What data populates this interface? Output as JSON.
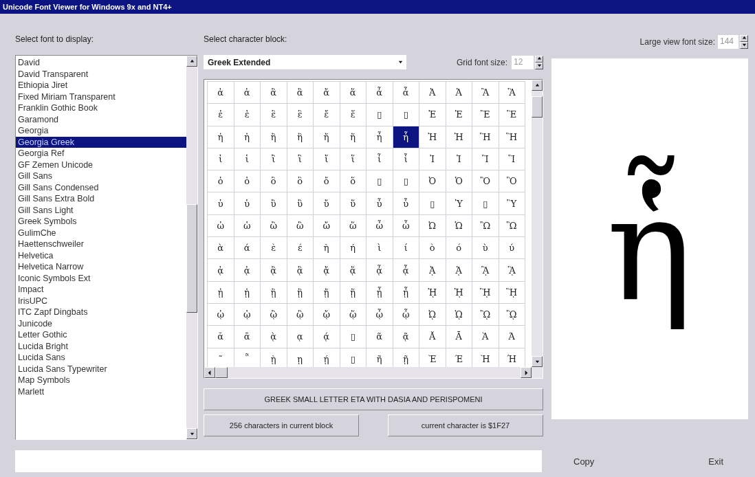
{
  "window": {
    "title": "Unicode Font Viewer for Windows 9x and NT4+"
  },
  "font_panel": {
    "label": "Select font to display:",
    "fonts": [
      {
        "name": "David",
        "selected": false
      },
      {
        "name": "David Transparent",
        "selected": false
      },
      {
        "name": "Ethiopia Jiret",
        "selected": false
      },
      {
        "name": "Fixed Miriam Transparent",
        "selected": false
      },
      {
        "name": "Franklin Gothic Book",
        "selected": false
      },
      {
        "name": "Garamond",
        "selected": false
      },
      {
        "name": "Georgia",
        "selected": false
      },
      {
        "name": "Georgia Greek",
        "selected": true
      },
      {
        "name": "Georgia Ref",
        "selected": false
      },
      {
        "name": "GF Zemen Unicode",
        "selected": false
      },
      {
        "name": "Gill Sans",
        "selected": false
      },
      {
        "name": "Gill Sans Condensed",
        "selected": false
      },
      {
        "name": "Gill Sans Extra Bold",
        "selected": false
      },
      {
        "name": "Gill Sans Light",
        "selected": false
      },
      {
        "name": "Greek Symbols",
        "selected": false
      },
      {
        "name": "GulimChe",
        "selected": false
      },
      {
        "name": "Haettenschweiler",
        "selected": false
      },
      {
        "name": "Helvetica",
        "selected": false
      },
      {
        "name": "Helvetica Narrow",
        "selected": false
      },
      {
        "name": "Iconic Symbols Ext",
        "selected": false
      },
      {
        "name": "Impact",
        "selected": false
      },
      {
        "name": "IrisUPC",
        "selected": false
      },
      {
        "name": "ITC Zapf Dingbats",
        "selected": false
      },
      {
        "name": "Junicode",
        "selected": false
      },
      {
        "name": "Letter Gothic",
        "selected": false
      },
      {
        "name": "Lucida Bright",
        "selected": false
      },
      {
        "name": "Lucida Sans",
        "selected": false
      },
      {
        "name": "Lucida Sans Typewriter",
        "selected": false
      },
      {
        "name": "Map Symbols",
        "selected": false
      },
      {
        "name": "Marlett",
        "selected": false
      }
    ]
  },
  "block_panel": {
    "label": "Select character block:",
    "block": "Greek Extended",
    "grid_font_size_label": "Grid font size:",
    "grid_font_size": "12"
  },
  "grid": {
    "rows": [
      {
        "cells": [
          "ἀ",
          "ἁ",
          "ἂ",
          "ἃ",
          "ἄ",
          "ἅ",
          "ἆ",
          "ἇ",
          "Ἀ",
          "Ἁ",
          "Ἂ",
          "Ἃ"
        ],
        "selected": [
          false,
          false,
          false,
          false,
          false,
          false,
          false,
          false,
          false,
          false,
          false,
          false
        ]
      },
      {
        "cells": [
          "ἐ",
          "ἑ",
          "ἒ",
          "ἓ",
          "ἔ",
          "ἕ",
          "▯",
          "▯",
          "Ἐ",
          "Ἑ",
          "Ἒ",
          "Ἓ"
        ],
        "selected": [
          false,
          false,
          false,
          false,
          false,
          false,
          false,
          false,
          false,
          false,
          false,
          false
        ]
      },
      {
        "cells": [
          "ἠ",
          "ἡ",
          "ἢ",
          "ἣ",
          "ἤ",
          "ἥ",
          "ἦ",
          "ἧ",
          "Ἠ",
          "Ἡ",
          "Ἢ",
          "Ἣ"
        ],
        "selected": [
          false,
          false,
          false,
          false,
          false,
          false,
          false,
          true,
          false,
          false,
          false,
          false
        ]
      },
      {
        "cells": [
          "ἰ",
          "ἱ",
          "ἲ",
          "ἳ",
          "ἴ",
          "ἵ",
          "ἶ",
          "ἷ",
          "Ἰ",
          "Ἱ",
          "Ἲ",
          "Ἳ"
        ],
        "selected": [
          false,
          false,
          false,
          false,
          false,
          false,
          false,
          false,
          false,
          false,
          false,
          false
        ]
      },
      {
        "cells": [
          "ὀ",
          "ὁ",
          "ὂ",
          "ὃ",
          "ὄ",
          "ὅ",
          "▯",
          "▯",
          "Ὀ",
          "Ὁ",
          "Ὂ",
          "Ὃ"
        ],
        "selected": [
          false,
          false,
          false,
          false,
          false,
          false,
          false,
          false,
          false,
          false,
          false,
          false
        ]
      },
      {
        "cells": [
          "ὐ",
          "ὑ",
          "ὒ",
          "ὓ",
          "ὔ",
          "ὕ",
          "ὖ",
          "ὗ",
          "▯",
          "Ὑ",
          "▯",
          "Ὓ"
        ],
        "selected": [
          false,
          false,
          false,
          false,
          false,
          false,
          false,
          false,
          false,
          false,
          false,
          false
        ]
      },
      {
        "cells": [
          "ὠ",
          "ὡ",
          "ὢ",
          "ὣ",
          "ὤ",
          "ὥ",
          "ὦ",
          "ὧ",
          "Ὠ",
          "Ὡ",
          "Ὢ",
          "Ὣ"
        ],
        "selected": [
          false,
          false,
          false,
          false,
          false,
          false,
          false,
          false,
          false,
          false,
          false,
          false
        ]
      },
      {
        "cells": [
          "ὰ",
          "ά",
          "ὲ",
          "έ",
          "ὴ",
          "ή",
          "ὶ",
          "ί",
          "ὸ",
          "ό",
          "ὺ",
          "ύ"
        ],
        "selected": [
          false,
          false,
          false,
          false,
          false,
          false,
          false,
          false,
          false,
          false,
          false,
          false
        ]
      },
      {
        "cells": [
          "ᾀ",
          "ᾁ",
          "ᾂ",
          "ᾃ",
          "ᾄ",
          "ᾅ",
          "ᾆ",
          "ᾇ",
          "ᾈ",
          "ᾉ",
          "ᾊ",
          "ᾋ"
        ],
        "selected": [
          false,
          false,
          false,
          false,
          false,
          false,
          false,
          false,
          false,
          false,
          false,
          false
        ]
      },
      {
        "cells": [
          "ᾐ",
          "ᾑ",
          "ᾒ",
          "ᾓ",
          "ᾔ",
          "ᾕ",
          "ᾖ",
          "ᾗ",
          "ᾘ",
          "ᾙ",
          "ᾚ",
          "ᾛ"
        ],
        "selected": [
          false,
          false,
          false,
          false,
          false,
          false,
          false,
          false,
          false,
          false,
          false,
          false
        ]
      },
      {
        "cells": [
          "ᾠ",
          "ᾡ",
          "ᾢ",
          "ᾣ",
          "ᾤ",
          "ᾥ",
          "ᾦ",
          "ᾧ",
          "ᾨ",
          "ᾩ",
          "ᾪ",
          "ᾫ"
        ],
        "selected": [
          false,
          false,
          false,
          false,
          false,
          false,
          false,
          false,
          false,
          false,
          false,
          false
        ]
      },
      {
        "cells": [
          "ᾰ",
          "ᾱ",
          "ᾲ",
          "ᾳ",
          "ᾴ",
          "▯",
          "ᾶ",
          "ᾷ",
          "Ᾰ",
          "Ᾱ",
          "Ὰ",
          "Ά"
        ],
        "selected": [
          false,
          false,
          false,
          false,
          false,
          false,
          false,
          false,
          false,
          false,
          false,
          false
        ]
      },
      {
        "cells": [
          "῀",
          "῁",
          "ῂ",
          "ῃ",
          "ῄ",
          "▯",
          "ῆ",
          "ῇ",
          "Ὲ",
          "Έ",
          "Ὴ",
          "Ή"
        ],
        "selected": [
          false,
          false,
          false,
          false,
          false,
          false,
          false,
          false,
          false,
          false,
          false,
          false
        ]
      }
    ]
  },
  "info": {
    "character_name": "GREEK SMALL LETTER ETA WITH DASIA AND PERISPOMENI",
    "count": "256 characters in current block",
    "current": "current character is $1F27"
  },
  "large_view": {
    "label": "Large view font size:",
    "size": "144",
    "character": "ἧ"
  },
  "buttons": [
    "Copy",
    "Exit"
  ]
}
